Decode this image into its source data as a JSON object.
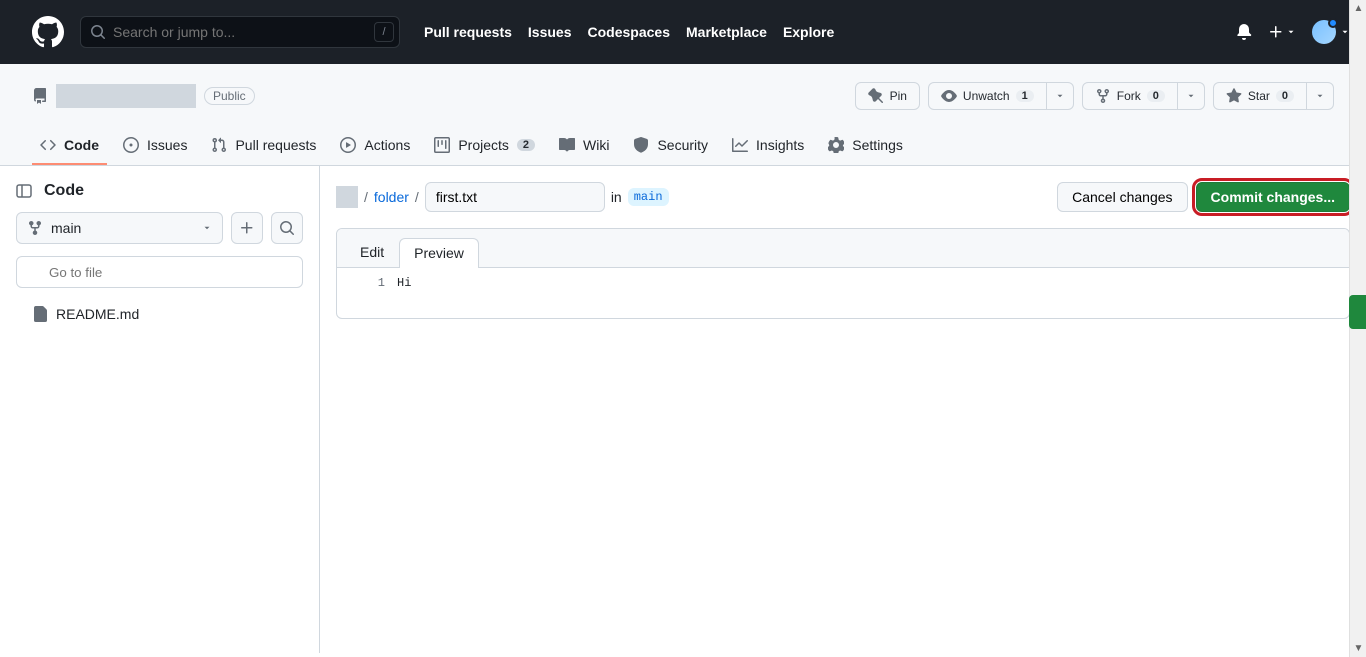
{
  "header": {
    "search_placeholder": "Search or jump to...",
    "nav": [
      "Pull requests",
      "Issues",
      "Codespaces",
      "Marketplace",
      "Explore"
    ]
  },
  "repo": {
    "visibility": "Public",
    "actions": {
      "pin": "Pin",
      "watch": "Unwatch",
      "watch_count": "1",
      "fork": "Fork",
      "fork_count": "0",
      "star": "Star",
      "star_count": "0"
    }
  },
  "tabs": {
    "code": "Code",
    "issues": "Issues",
    "pulls": "Pull requests",
    "actions": "Actions",
    "projects": "Projects",
    "projects_count": "2",
    "wiki": "Wiki",
    "security": "Security",
    "insights": "Insights",
    "settings": "Settings"
  },
  "sidebar": {
    "title": "Code",
    "branch": "main",
    "file_filter_placeholder": "Go to file",
    "files": [
      "README.md"
    ]
  },
  "editor": {
    "breadcrumb_folder": "folder",
    "filename": "first.txt",
    "in_label": "in",
    "branch": "main",
    "cancel": "Cancel changes",
    "commit": "Commit changes...",
    "tab_edit": "Edit",
    "tab_preview": "Preview",
    "lines": [
      {
        "n": "1",
        "text": "Hi"
      }
    ]
  }
}
